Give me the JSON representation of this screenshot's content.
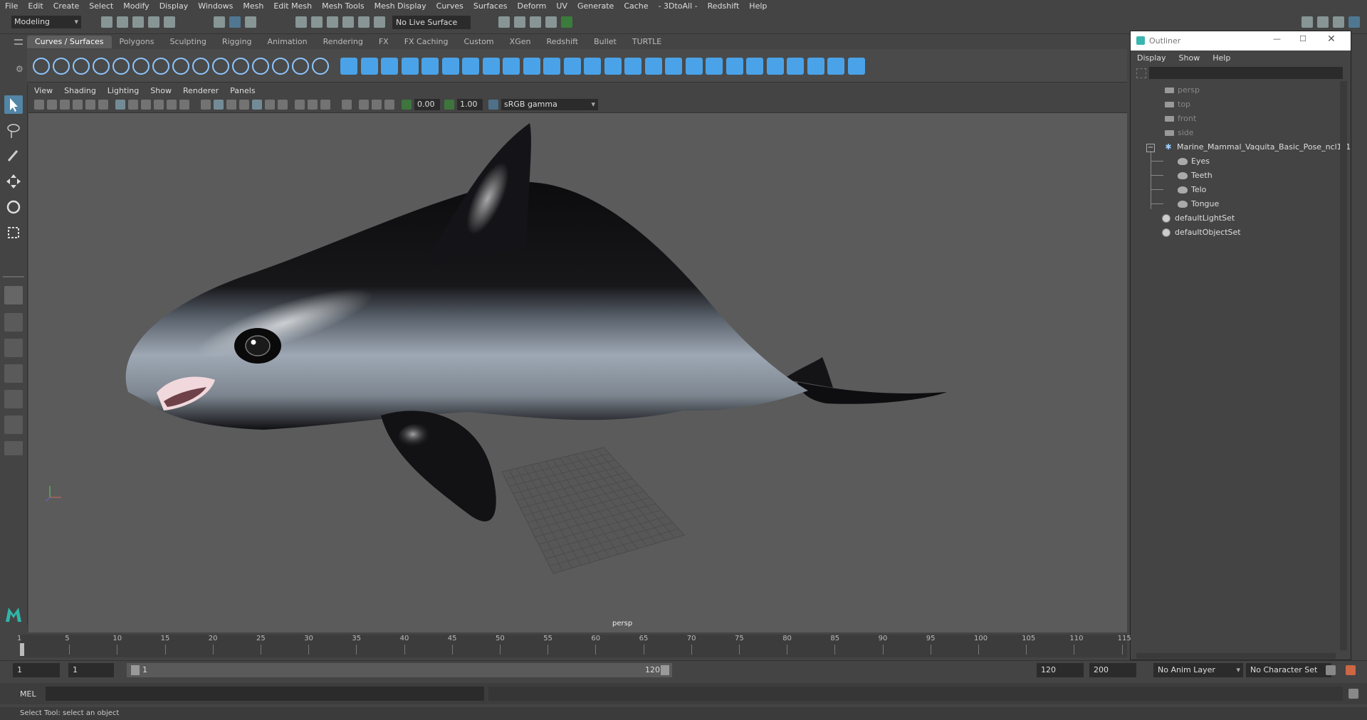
{
  "menubar": [
    "File",
    "Edit",
    "Create",
    "Select",
    "Modify",
    "Display",
    "Windows",
    "Mesh",
    "Edit Mesh",
    "Mesh Tools",
    "Mesh Display",
    "Curves",
    "Surfaces",
    "Deform",
    "UV",
    "Generate",
    "Cache",
    "- 3DtoAll -",
    "Redshift",
    "Help"
  ],
  "status": {
    "mode": "Modeling",
    "live_surface": "No Live Surface"
  },
  "shelf_tabs": [
    "Curves / Surfaces",
    "Polygons",
    "Sculpting",
    "Rigging",
    "Animation",
    "Rendering",
    "FX",
    "FX Caching",
    "Custom",
    "XGen",
    "Redshift",
    "Bullet",
    "TURTLE"
  ],
  "panel_menu": [
    "View",
    "Shading",
    "Lighting",
    "Show",
    "Renderer",
    "Panels"
  ],
  "viewport": {
    "exposure": "0.00",
    "gamma": "1.00",
    "color_space": "sRGB gamma",
    "camera_label": "persp"
  },
  "outliner": {
    "title": "Outliner",
    "menu": [
      "Display",
      "Show",
      "Help"
    ],
    "cameras": [
      "persp",
      "top",
      "front",
      "side"
    ],
    "group": "Marine_Mammal_Vaquita_Basic_Pose_ncl1_1",
    "children": [
      "Eyes",
      "Teeth",
      "Telo",
      "Tongue"
    ],
    "sets": [
      "defaultLightSet",
      "defaultObjectSet"
    ]
  },
  "timeline": {
    "ticks": [
      "1",
      "5",
      "10",
      "15",
      "20",
      "25",
      "30",
      "35",
      "40",
      "45",
      "50",
      "55",
      "60",
      "65",
      "70",
      "75",
      "80",
      "85",
      "90",
      "95",
      "100",
      "105",
      "110",
      "115"
    ]
  },
  "range": {
    "current_start": "1",
    "start": "1",
    "slider_start": "1",
    "slider_end": "120",
    "end": "120",
    "max_end": "200",
    "anim_layer": "No Anim Layer",
    "char_set": "No Character Set"
  },
  "command": {
    "label": "MEL"
  },
  "help_line": "Select Tool: select an object",
  "colors": {
    "ui_bg": "#444444",
    "viewport_bg": "#5b5b5b",
    "accent": "#5285a6",
    "shelf_blue": "#4aa3e8"
  }
}
